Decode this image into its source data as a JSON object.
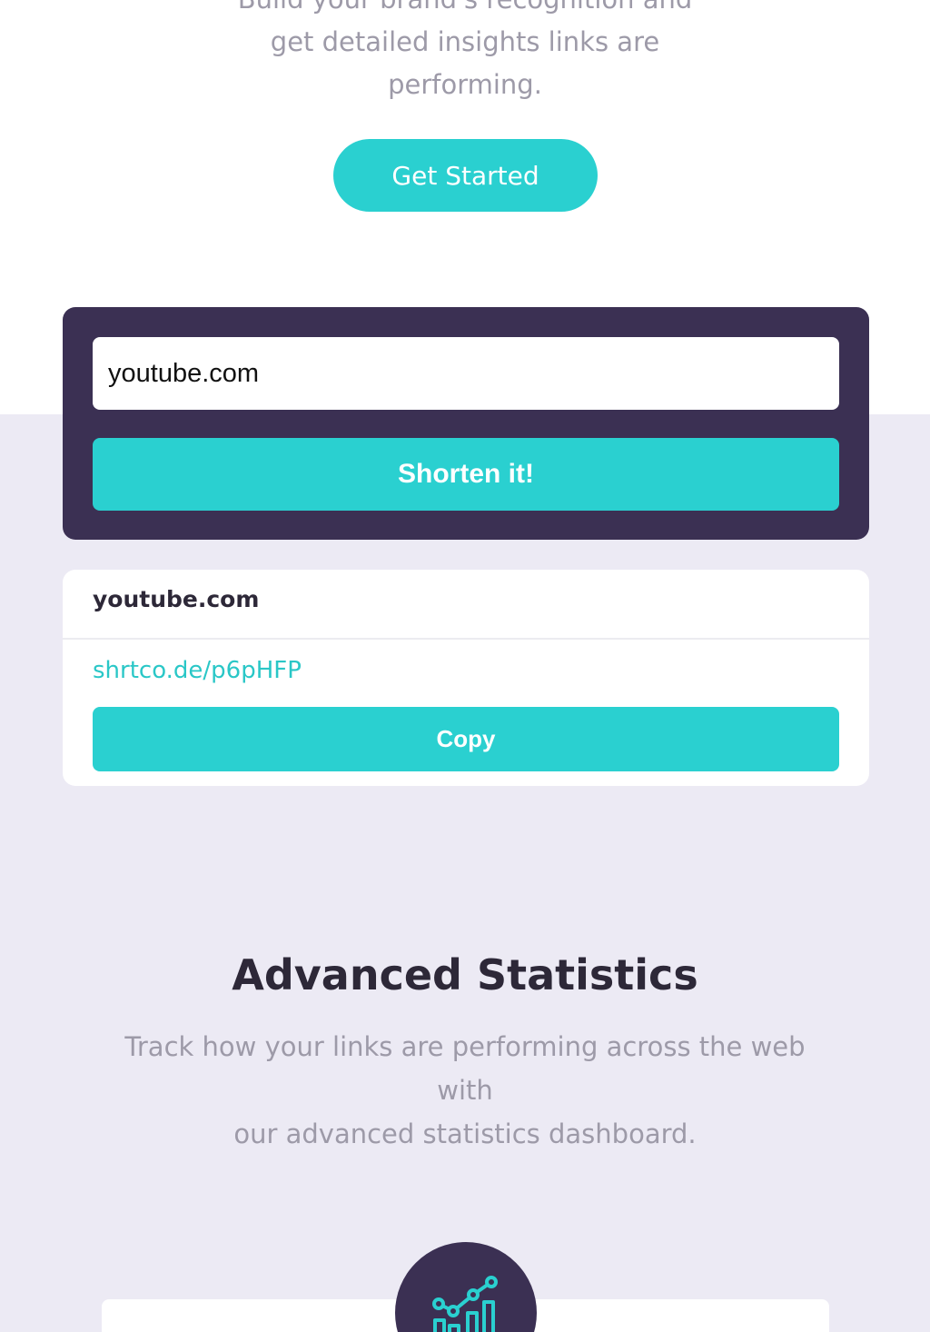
{
  "hero": {
    "description_lines": [
      "Build your brand's recognition and",
      "get detailed insights links are",
      "performing."
    ],
    "cta_label": "Get Started"
  },
  "shortener": {
    "input_value": "youtube.com",
    "button_label": "Shorten it!"
  },
  "result": {
    "original_url": "youtube.com",
    "short_url": "shrtco.de/p6pHFP",
    "copy_label": "Copy"
  },
  "statistics": {
    "title": "Advanced Statistics",
    "description_lines": [
      "Track how your links are performing across the web",
      "with",
      "our advanced statistics dashboard."
    ]
  },
  "feature": {
    "icon": "brand-recognition-chart-icon"
  },
  "colors": {
    "accent": "#2ad0d0",
    "dark_violet": "#3b3053",
    "background_light": "#eceaf4",
    "text_gray": "#9d9aa8",
    "text_dark": "#2d2838"
  }
}
